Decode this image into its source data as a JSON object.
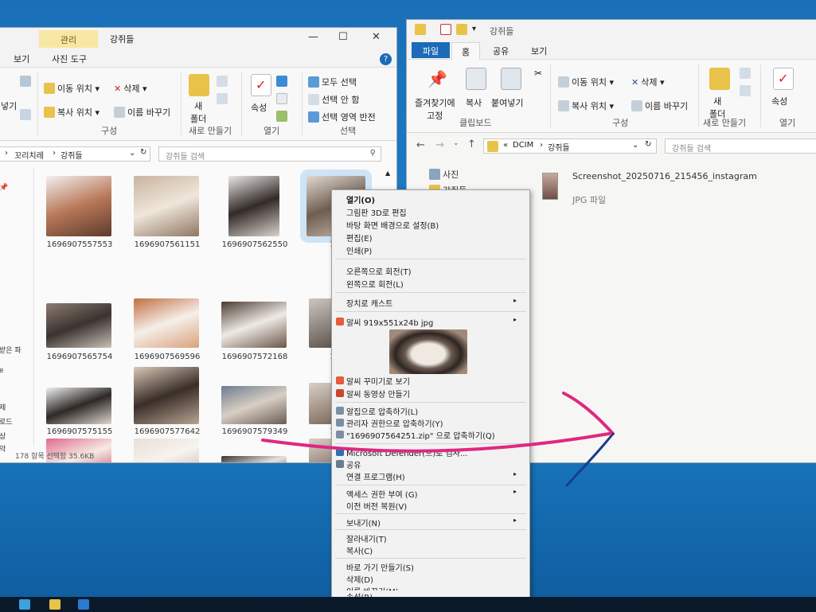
{
  "left_window": {
    "context_tab": "관리",
    "context_tab_title": "강쥐들",
    "tabs": [
      "보기",
      "사진 도구"
    ],
    "ribbon": {
      "move_to": "이동 위치",
      "delete": "삭제",
      "copy_to": "복사 위치",
      "rename": "이름 바꾸기",
      "new_folder": "새\n폴더",
      "properties": "속성",
      "select_all": "모두 선택",
      "select_none": "선택 안 함",
      "invert_selection": "선택 영역 반전",
      "groups": [
        "구성",
        "새로 만들기",
        "열기",
        "선택"
      ],
      "left_cut_label": "넣기"
    },
    "breadcrumb": [
      "꼬리치레",
      "강쥐들"
    ],
    "search_placeholder": "강쥐들 검색",
    "nav_items": [
      "받은 파",
      "e",
      "제",
      "로드",
      "상",
      "악",
      "탕 화면"
    ],
    "thumbnails": [
      "1696907557553",
      "1696907561151",
      "1696907562550",
      "16969",
      "1696907565754",
      "1696907569596",
      "1696907572168",
      "16969",
      "1696907575155",
      "1696907577642",
      "1696907579349",
      "16969",
      "",
      "",
      "",
      ""
    ],
    "status": "178 항목   선택함 35.6KB"
  },
  "right_window": {
    "title": "강쥐들",
    "tabs": [
      "파일",
      "홈",
      "공유",
      "보기"
    ],
    "ribbon": {
      "pin": "즐겨찾기에\n고정",
      "copy": "복사",
      "paste": "붙여넣기",
      "move_to": "이동 위치",
      "delete": "삭제",
      "copy_to": "복사 위치",
      "rename": "이름 바꾸기",
      "new_folder": "새\n폴더",
      "properties": "속성",
      "groups": [
        "클립보드",
        "구성",
        "새로 만들기",
        "열기"
      ]
    },
    "address": [
      "DCIM",
      "강쥐들"
    ],
    "address_prefix": "«",
    "search_placeholder": "강쥐들 검색",
    "nav": [
      "사진",
      "강쥐들"
    ],
    "file": {
      "name": "Screenshot_20250716_215456_instagram",
      "type": "JPG 파일"
    }
  },
  "context_menu": {
    "items": [
      {
        "label": "열기(O)",
        "bold": true
      },
      {
        "label": "그림판 3D로 편집"
      },
      {
        "label": "바탕 화면 배경으로 설정(B)"
      },
      {
        "label": "편집(E)"
      },
      {
        "label": "인쇄(P)"
      },
      {
        "label": "오른쪽으로 회전(T)"
      },
      {
        "label": "왼쪽으로 회전(L)"
      },
      {
        "label": "장치로 캐스트",
        "submenu": true
      },
      {
        "label": "알씨 919x551x24b jpg",
        "submenu": true
      },
      {
        "label": "알씨 꾸미기로 보기"
      },
      {
        "label": "알씨 동영상 만들기"
      },
      {
        "label": "알집으로 압축하기(L)"
      },
      {
        "label": "관리자 권한으로 압축하기(Y)"
      },
      {
        "label": "\"1696907564251.zip\" 으로 압축하기(Q)"
      },
      {
        "label": "Microsoft Defender(으)로 검사..."
      },
      {
        "label": "공유"
      },
      {
        "label": "연결 프로그램(H)",
        "submenu": true
      },
      {
        "label": "액세스 권한 부여 (G)",
        "submenu": true
      },
      {
        "label": "이전 버전 복원(V)"
      },
      {
        "label": "보내기(N)",
        "submenu": true
      },
      {
        "label": "잘라내기(T)"
      },
      {
        "label": "복사(C)"
      },
      {
        "label": "바로 가기 만들기(S)"
      },
      {
        "label": "삭제(D)"
      },
      {
        "label": "이름 바꾸기(M)"
      },
      {
        "label": "속성(R)"
      }
    ],
    "arrow_glyph": "▸"
  },
  "colors": {
    "desktop": "#1d7cc6",
    "annotation_arrow_pink": "#e0287f",
    "annotation_arrow_blue": "#1a3d8a",
    "selected_tab": "#1c6ab8"
  },
  "icons": [
    "folder-icon",
    "check-icon",
    "scissors-icon",
    "copy-icon",
    "paste-icon",
    "pin-icon",
    "delete-icon",
    "properties-icon",
    "search-icon",
    "refresh-icon",
    "help-icon"
  ]
}
